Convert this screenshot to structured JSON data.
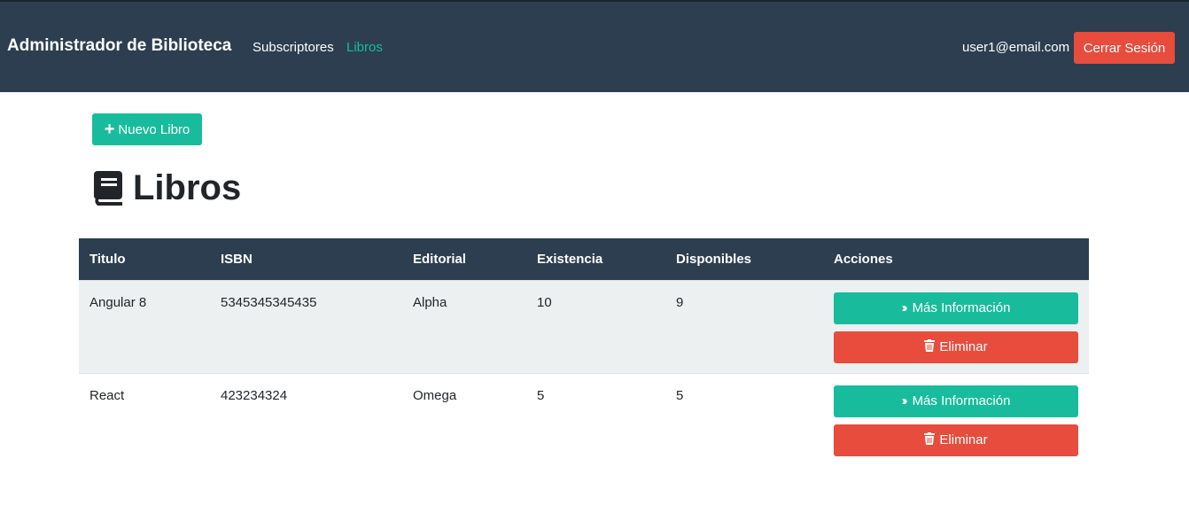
{
  "header": {
    "brand": "Administrador de Biblioteca",
    "nav": [
      {
        "label": "Subscriptores"
      },
      {
        "label": "Libros"
      }
    ],
    "user_email": "user1@email.com",
    "logout_label": "Cerrar Sesión"
  },
  "toolbar": {
    "new_book_label": "Nuevo Libro",
    "new_book_icon": "plus-icon"
  },
  "page": {
    "title": "Libros",
    "title_icon": "book-icon"
  },
  "table": {
    "columns": [
      "Titulo",
      "ISBN",
      "Editorial",
      "Existencia",
      "Disponibles",
      "Acciones"
    ],
    "rows": [
      {
        "titulo": "Angular 8",
        "isbn": "5345345345435",
        "editorial": "Alpha",
        "existencia": "10",
        "disponibles": "9"
      },
      {
        "titulo": "React",
        "isbn": "423234324",
        "editorial": "Omega",
        "existencia": "5",
        "disponibles": "5"
      }
    ],
    "info_label": "Más Información",
    "delete_label": "Eliminar"
  },
  "colors": {
    "navbar": "#2c3e50",
    "accent_green": "#18bc9c",
    "danger_red": "#e74c3c",
    "row_stripe": "#ecf0f1"
  }
}
